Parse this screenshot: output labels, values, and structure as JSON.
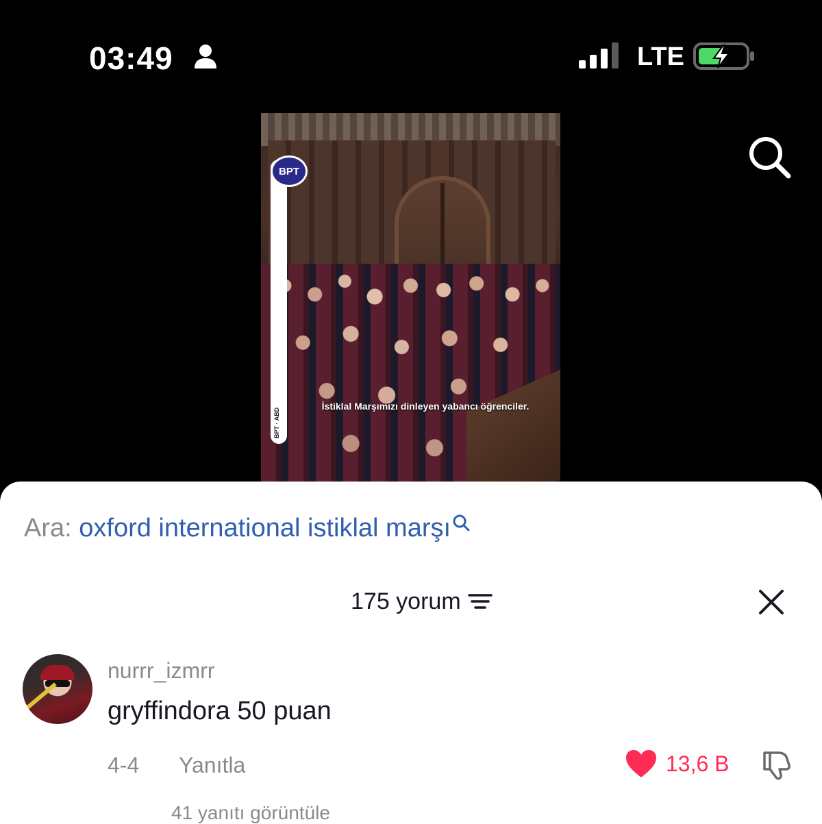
{
  "status_bar": {
    "time": "03:49",
    "network": "LTE",
    "icons": [
      "person-icon",
      "signal-icon",
      "battery-charging-icon"
    ]
  },
  "header": {
    "icons": [
      "search-icon"
    ]
  },
  "video": {
    "logo": "BPT",
    "side_text": "BPT · ABD",
    "caption": "İstiklal Marşımızı dinleyen yabancı öğrenciler."
  },
  "comments_sheet": {
    "search_prefix": "Ara:",
    "search_query": "oxford international istiklal marşı",
    "comment_count": "175 yorum",
    "comments": [
      {
        "username": "nurrr_izmrr",
        "text": "gryffindora 50 puan",
        "date": "4-4",
        "reply_label": "Yanıtla",
        "likes": "13,6 B",
        "liked": true
      }
    ],
    "more_replies": "41 yanıtı görüntüle"
  },
  "colors": {
    "accent_blue": "#2f5fb0",
    "like_red": "#fe2c55",
    "battery_green": "#4cd964"
  }
}
